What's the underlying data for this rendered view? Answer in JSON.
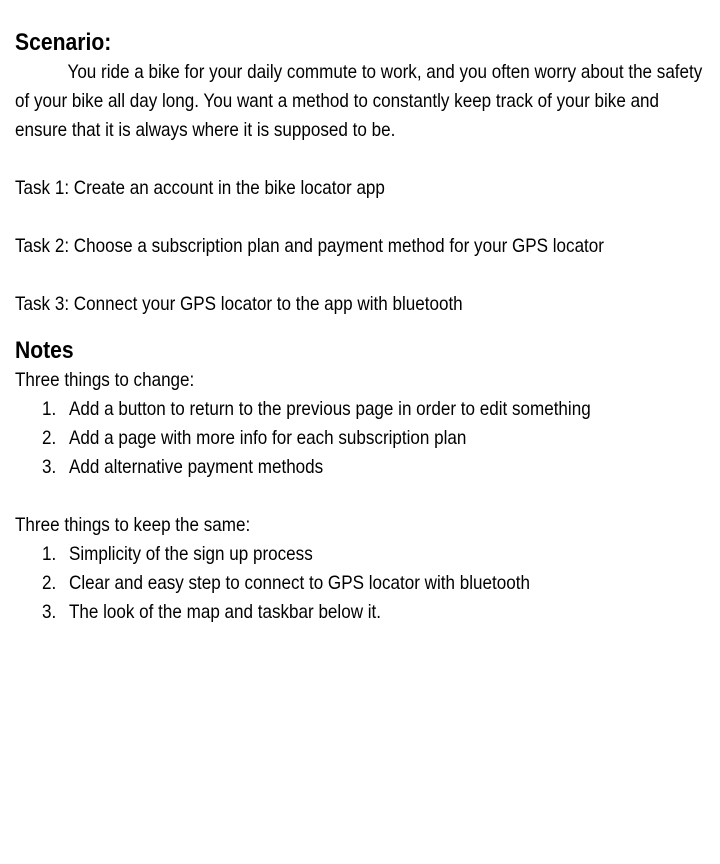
{
  "scenario": {
    "heading": "Scenario:",
    "body": "You ride a bike for your daily commute to work, and you often worry about the safety of your bike all day long. You want a method to constantly keep track of your bike and ensure that it is always where it is supposed to be."
  },
  "tasks": [
    {
      "text": "Task 1: Create an account in the bike locator app"
    },
    {
      "text": "Task 2: Choose a subscription plan and payment method for your GPS locator"
    },
    {
      "text": "Task 3: Connect your GPS locator to the app with bluetooth"
    }
  ],
  "notes": {
    "heading": "Notes",
    "change": {
      "intro": "Three things to change:",
      "items": [
        {
          "num": "1.",
          "text": "Add a button to return to the previous page in order to edit something"
        },
        {
          "num": "2.",
          "text": "Add a page with more info for each subscription plan"
        },
        {
          "num": "3.",
          "text": "Add alternative payment methods"
        }
      ]
    },
    "keep": {
      "intro": "Three things to keep the same:",
      "items": [
        {
          "num": "1.",
          "text": "Simplicity of the sign up process"
        },
        {
          "num": "2.",
          "text": "Clear and easy step to connect to GPS locator with bluetooth"
        },
        {
          "num": "3.",
          "text": "The look of the map and taskbar below it."
        }
      ]
    }
  }
}
